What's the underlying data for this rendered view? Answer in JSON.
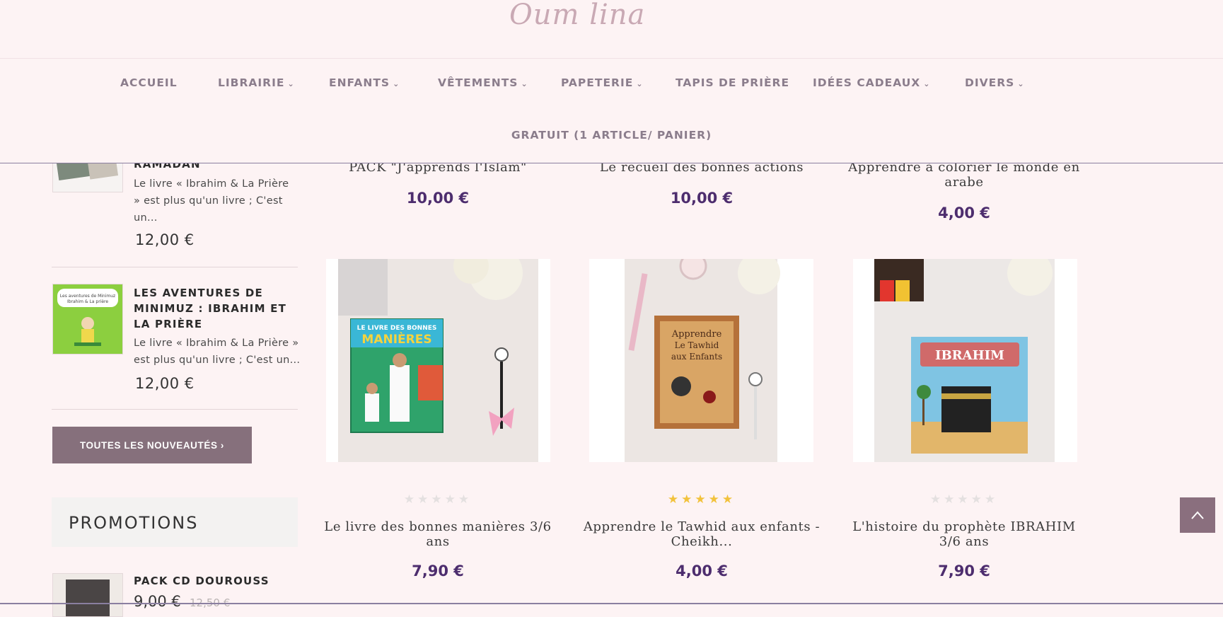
{
  "logo": {
    "text": "Oum lina"
  },
  "nav": {
    "items": [
      {
        "label": "ACCUEIL",
        "dropdown": false
      },
      {
        "label": "LIBRAIRIE",
        "dropdown": true
      },
      {
        "label": "ENFANTS",
        "dropdown": true
      },
      {
        "label": "VÊTEMENTS",
        "dropdown": true
      },
      {
        "label": "PAPETERIE",
        "dropdown": true
      },
      {
        "label": "TAPIS DE PRIÈRE",
        "dropdown": false
      },
      {
        "label": "IDÉES CADEAUX",
        "dropdown": true
      },
      {
        "label": "DIVERS",
        "dropdown": true
      }
    ],
    "second_row": {
      "label": "GRATUIT (1 ARTICLE/ PANIER)"
    }
  },
  "sidebar": {
    "items": [
      {
        "title": "RAMADAN",
        "desc": "Le livre « Ibrahim & La Prière » est plus qu'un livre ; C'est un...",
        "price": "12,00 €"
      },
      {
        "title": "LES AVENTURES DE MINIMUZ : IBRAHIM ET LA PRIÈRE",
        "desc": "Le livre « Ibrahim & La Prière » est plus qu'un livre ; C'est un...",
        "price": "12,00 €",
        "thumb_text": "Les aventures de Minimuz Ibrahim & La prière"
      }
    ],
    "all_new_button": "TOUTES LES NOUVEAUTÉS ›",
    "promotions_title": "PROMOTIONS",
    "promo_item": {
      "title": "PACK CD DOUROUSS",
      "price": "9,00 €",
      "old_price": "12,50 €"
    }
  },
  "products_top": [
    {
      "title": "PACK \"J'apprends l'Islam\"",
      "price": "10,00 €"
    },
    {
      "title": "Le recueil des bonnes actions",
      "price": "10,00 €"
    },
    {
      "title": "Apprendre à colorier le monde en arabe",
      "price": "4,00 €"
    }
  ],
  "products": [
    {
      "title": "Le livre des bonnes manières 3/6 ans",
      "price": "7,90 €",
      "rating": 0,
      "cover_text": "LE LIVRE DES BONNES MANIÈRES"
    },
    {
      "title": "Apprendre le Tawhid aux enfants - Cheikh...",
      "price": "4,00 €",
      "rating": 5,
      "cover_text": "Apprendre Le Tawhid aux Enfants"
    },
    {
      "title": "L'histoire du prophète IBRAHIM 3/6 ans",
      "price": "7,90 €",
      "rating": 0,
      "cover_text": "IBRAHIM"
    }
  ],
  "colors": {
    "accent": "#4d2d6e",
    "button": "#86707c",
    "background": "#fdf3f4",
    "star": "#f2c23b"
  }
}
